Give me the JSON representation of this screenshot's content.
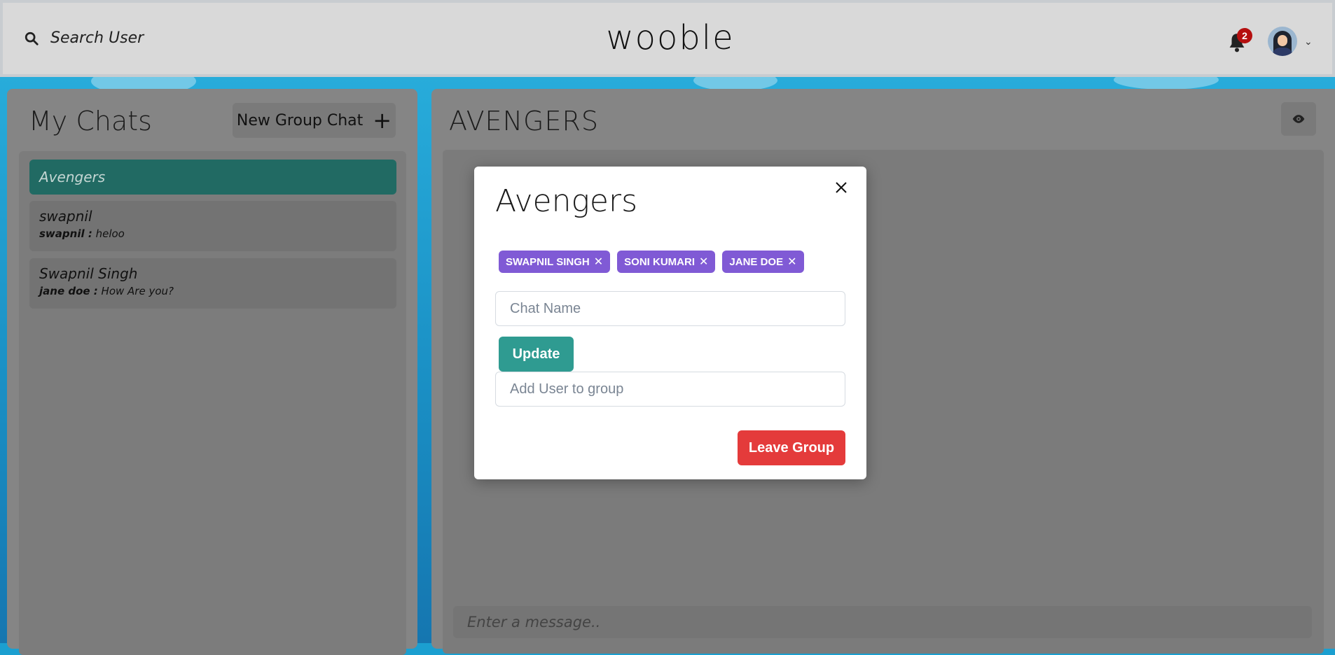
{
  "header": {
    "search_label": "Search User",
    "logo": "wooble",
    "notification_count": "2"
  },
  "sidebar": {
    "title": "My Chats",
    "new_group_label": "New Group Chat",
    "chats": [
      {
        "name": "Avengers",
        "active": true
      },
      {
        "name": "swapnil",
        "preview_sender": "swapnil :",
        "preview_text": " heloo"
      },
      {
        "name": "Swapnil Singh",
        "preview_sender": "jane doe :",
        "preview_text": " How Are you?"
      }
    ]
  },
  "chat": {
    "title": "AVENGERS",
    "message_placeholder": "Enter a message.."
  },
  "modal": {
    "title": "Avengers",
    "members": [
      "SWAPNIL SINGH",
      "SONI KUMARI",
      "JANE DOE"
    ],
    "chat_name_placeholder": "Chat Name",
    "update_label": "Update",
    "add_user_placeholder": "Add User to group",
    "leave_label": "Leave Group"
  },
  "colors": {
    "accent_teal": "#2f9b91",
    "tag_purple": "#805ad5",
    "danger_red": "#e43b3b",
    "active_chat": "#216a63"
  }
}
